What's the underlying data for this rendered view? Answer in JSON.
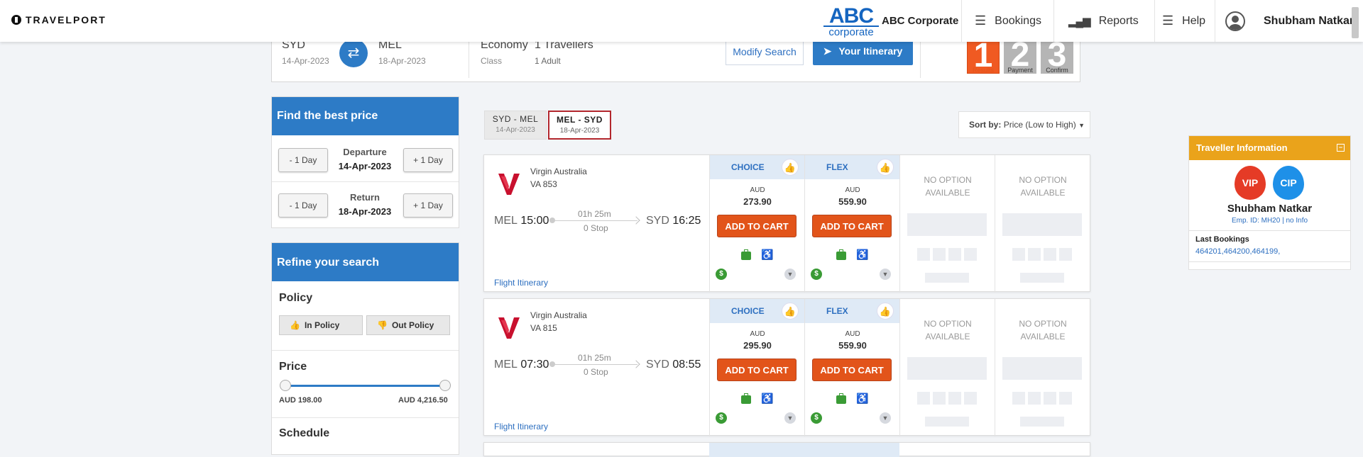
{
  "brand": {
    "name": "TRAVELPORT",
    "corp_logo_top": "ABC",
    "corp_logo_bottom": "corporate",
    "corp_name": "ABC Corporate"
  },
  "nav": {
    "bookings": "Bookings",
    "reports": "Reports",
    "help": "Help",
    "user": "Shubham Natkar"
  },
  "search": {
    "from_city": "SYD",
    "from_date": "14-Apr-2023",
    "to_city": "MEL",
    "to_date": "18-Apr-2023",
    "cabin": "Economy",
    "cabin_label": "Class",
    "travellers": "1 Travellers",
    "travellers_sub": "1 Adult",
    "modify": "Modify Search",
    "itinerary": "Your Itinerary"
  },
  "steps": [
    {
      "num": "1",
      "label": "Results",
      "color": "#f05a22"
    },
    {
      "num": "2",
      "label": "Payment",
      "color": "#b5b5b5"
    },
    {
      "num": "3",
      "label": "Confirm",
      "color": "#b5b5b5"
    }
  ],
  "best_price": {
    "title": "Find the best price",
    "minus": "- 1 Day",
    "plus": "+ 1 Day",
    "departure_label": "Departure",
    "departure_date": "14-Apr-2023",
    "return_label": "Return",
    "return_date": "18-Apr-2023"
  },
  "refine": {
    "title": "Refine your search",
    "policy": "Policy",
    "in_policy": "In Policy",
    "out_policy": "Out Policy",
    "price": "Price",
    "price_min": "AUD 198.00",
    "price_max": "AUD 4,216.50",
    "schedule": "Schedule"
  },
  "tabs": [
    {
      "route": "SYD  -  MEL",
      "date": "14-Apr-2023",
      "active": false
    },
    {
      "route": "MEL  -  SYD",
      "date": "18-Apr-2023",
      "active": true
    }
  ],
  "sort": {
    "label": "Sort by:",
    "value": "Price (Low to High)"
  },
  "flights": [
    {
      "airline": "Virgin Australia",
      "flight_no": "VA  853",
      "dep_code": "MEL",
      "dep_time": "15:00",
      "arr_code": "SYD",
      "arr_time": "16:25",
      "duration": "01h 25m",
      "stops": "0 Stop",
      "link": "Flight Itinerary",
      "fares": [
        {
          "name": "CHOICE",
          "currency": "AUD",
          "price": "273.90",
          "button": "ADD TO CART"
        },
        {
          "name": "FLEX",
          "currency": "AUD",
          "price": "559.90",
          "button": "ADD TO CART"
        }
      ],
      "no_option_1": "NO OPTION AVAILABLE",
      "no_option_2": "NO OPTION AVAILABLE"
    },
    {
      "airline": "Virgin Australia",
      "flight_no": "VA  815",
      "dep_code": "MEL",
      "dep_time": "07:30",
      "arr_code": "SYD",
      "arr_time": "08:55",
      "duration": "01h 25m",
      "stops": "0 Stop",
      "link": "Flight Itinerary",
      "fares": [
        {
          "name": "CHOICE",
          "currency": "AUD",
          "price": "295.90",
          "button": "ADD TO CART"
        },
        {
          "name": "FLEX",
          "currency": "AUD",
          "price": "559.90",
          "button": "ADD TO CART"
        }
      ],
      "no_option_1": "NO OPTION AVAILABLE",
      "no_option_2": "NO OPTION AVAILABLE"
    }
  ],
  "traveller": {
    "title": "Traveller Information",
    "vip": "VIP",
    "cip": "CIP",
    "name": "Shubham Natkar",
    "emp": "Emp. ID: MH20 | no Info",
    "last_label": "Last Bookings",
    "last_values": "464201,464200,464199,"
  },
  "colors": {
    "primary": "#2d7bc6",
    "accent": "#e2541a",
    "ok": "#3a9b35",
    "traveller": "#eaa31b"
  }
}
